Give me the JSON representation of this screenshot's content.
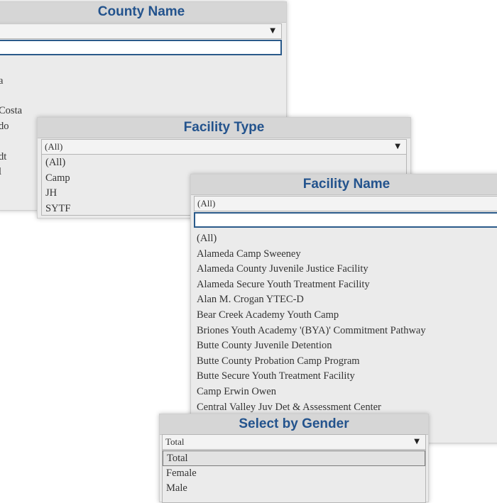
{
  "county": {
    "title": "County Name",
    "visible_fragments": [
      "a",
      "Costa",
      "do",
      "dt",
      "l"
    ]
  },
  "facility_type": {
    "title": "Facility Type",
    "selected": "(All)",
    "options": [
      "(All)",
      "Camp",
      "JH",
      "SYTF"
    ]
  },
  "facility_name": {
    "title": "Facility Name",
    "selected": "(All)",
    "options": [
      "(All)",
      "Alameda Camp Sweeney",
      "Alameda County Juvenile Justice Facility",
      "Alameda Secure Youth Treatment Facility",
      "Alan M. Crogan YTEC-D",
      "Bear Creek Academy Youth Camp",
      "Briones Youth Academy '(BYA)' Commitment Pathway",
      "Butte County Juvenile Detention",
      "Butte County Probation Camp Program",
      "Butte Secure Youth Treatment Facility",
      "Camp Erwin Owen",
      "Central Valley Juv Det & Assessment Center"
    ]
  },
  "gender": {
    "title": "Select by Gender",
    "selected": "Total",
    "options": [
      "Total",
      "Female",
      "Male"
    ]
  },
  "icons": {
    "dropdown": "caret-down-icon",
    "caret_glyph": "▼"
  },
  "colors": {
    "title_text": "#23538d",
    "focus_border": "#2a5a8a"
  }
}
